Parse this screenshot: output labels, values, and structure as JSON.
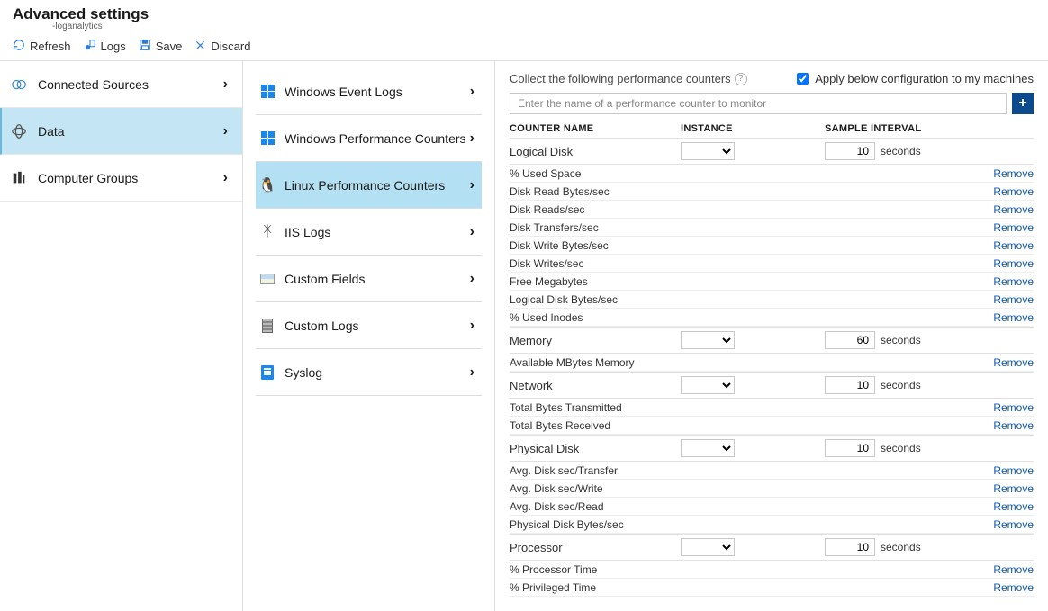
{
  "header": {
    "title": "Advanced settings",
    "subtitle": "-loganalytics"
  },
  "toolbar": {
    "refresh": "Refresh",
    "logs": "Logs",
    "save": "Save",
    "discard": "Discard"
  },
  "left_nav": [
    {
      "label": "Connected Sources",
      "selected": false
    },
    {
      "label": "Data",
      "selected": true
    },
    {
      "label": "Computer Groups",
      "selected": false
    }
  ],
  "mid_nav": [
    {
      "label": "Windows Event Logs",
      "icon": "windows",
      "selected": false
    },
    {
      "label": "Windows Performance Counters",
      "icon": "windows",
      "selected": false
    },
    {
      "label": "Linux Performance Counters",
      "icon": "penguin",
      "selected": true
    },
    {
      "label": "IIS Logs",
      "icon": "iis",
      "selected": false
    },
    {
      "label": "Custom Fields",
      "icon": "fields",
      "selected": false
    },
    {
      "label": "Custom Logs",
      "icon": "logs",
      "selected": false
    },
    {
      "label": "Syslog",
      "icon": "syslog",
      "selected": false
    }
  ],
  "right": {
    "collect_label": "Collect the following performance counters",
    "apply_label": "Apply below configuration to my machines",
    "apply_checked": true,
    "add_placeholder": "Enter the name of a performance counter to monitor",
    "columns": {
      "name": "COUNTER NAME",
      "instance": "INSTANCE",
      "interval": "SAMPLE INTERVAL"
    },
    "seconds_label": "seconds",
    "remove_label": "Remove",
    "groups": [
      {
        "name": "Logical Disk",
        "interval": "10",
        "children": [
          "% Used Space",
          "Disk Read Bytes/sec",
          "Disk Reads/sec",
          "Disk Transfers/sec",
          "Disk Write Bytes/sec",
          "Disk Writes/sec",
          "Free Megabytes",
          "Logical Disk Bytes/sec",
          "% Used Inodes"
        ]
      },
      {
        "name": "Memory",
        "interval": "60",
        "children": [
          "Available MBytes Memory"
        ]
      },
      {
        "name": "Network",
        "interval": "10",
        "children": [
          "Total Bytes Transmitted",
          "Total Bytes Received"
        ]
      },
      {
        "name": "Physical Disk",
        "interval": "10",
        "children": [
          "Avg. Disk sec/Transfer",
          "Avg. Disk sec/Write",
          "Avg. Disk sec/Read",
          "Physical Disk Bytes/sec"
        ]
      },
      {
        "name": "Processor",
        "interval": "10",
        "children": [
          "% Processor Time",
          "% Privileged Time"
        ]
      }
    ]
  }
}
